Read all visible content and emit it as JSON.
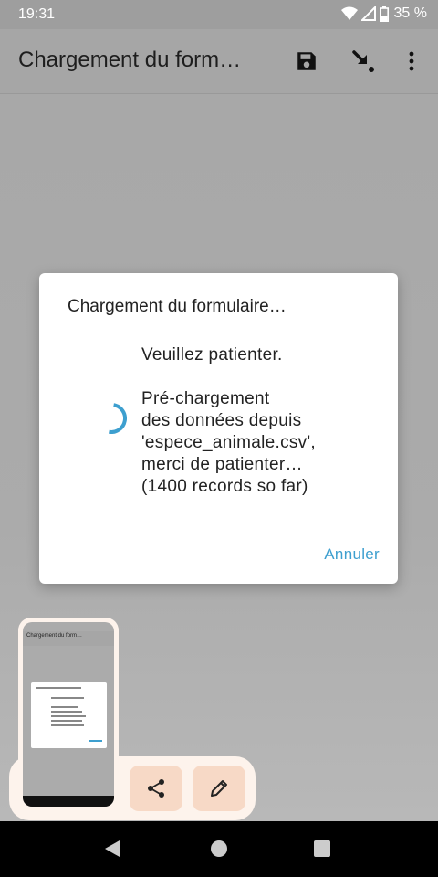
{
  "status_bar": {
    "time": "19:31",
    "battery": "35 %",
    "icons": [
      "wifi-icon",
      "signal-icon",
      "battery-icon"
    ]
  },
  "app_bar": {
    "title": "Chargement du form…",
    "actions": [
      "save-icon",
      "download-icon",
      "more-vert-icon"
    ]
  },
  "dialog": {
    "title": "Chargement du formulaire…",
    "message_line1": "Veuillez patienter.",
    "message_lines": [
      "Pré-chargement",
      "des données depuis",
      "'espece_animale.csv',",
      "merci de patienter…",
      "(1400 records so far)"
    ],
    "cancel_label": "Annuler",
    "accent_color": "#3d9fcf"
  },
  "screenshot_preview": {
    "actions": [
      "share-icon",
      "edit-icon"
    ]
  },
  "nav_bar": {
    "buttons": [
      "back-icon",
      "home-icon",
      "recents-icon"
    ]
  }
}
